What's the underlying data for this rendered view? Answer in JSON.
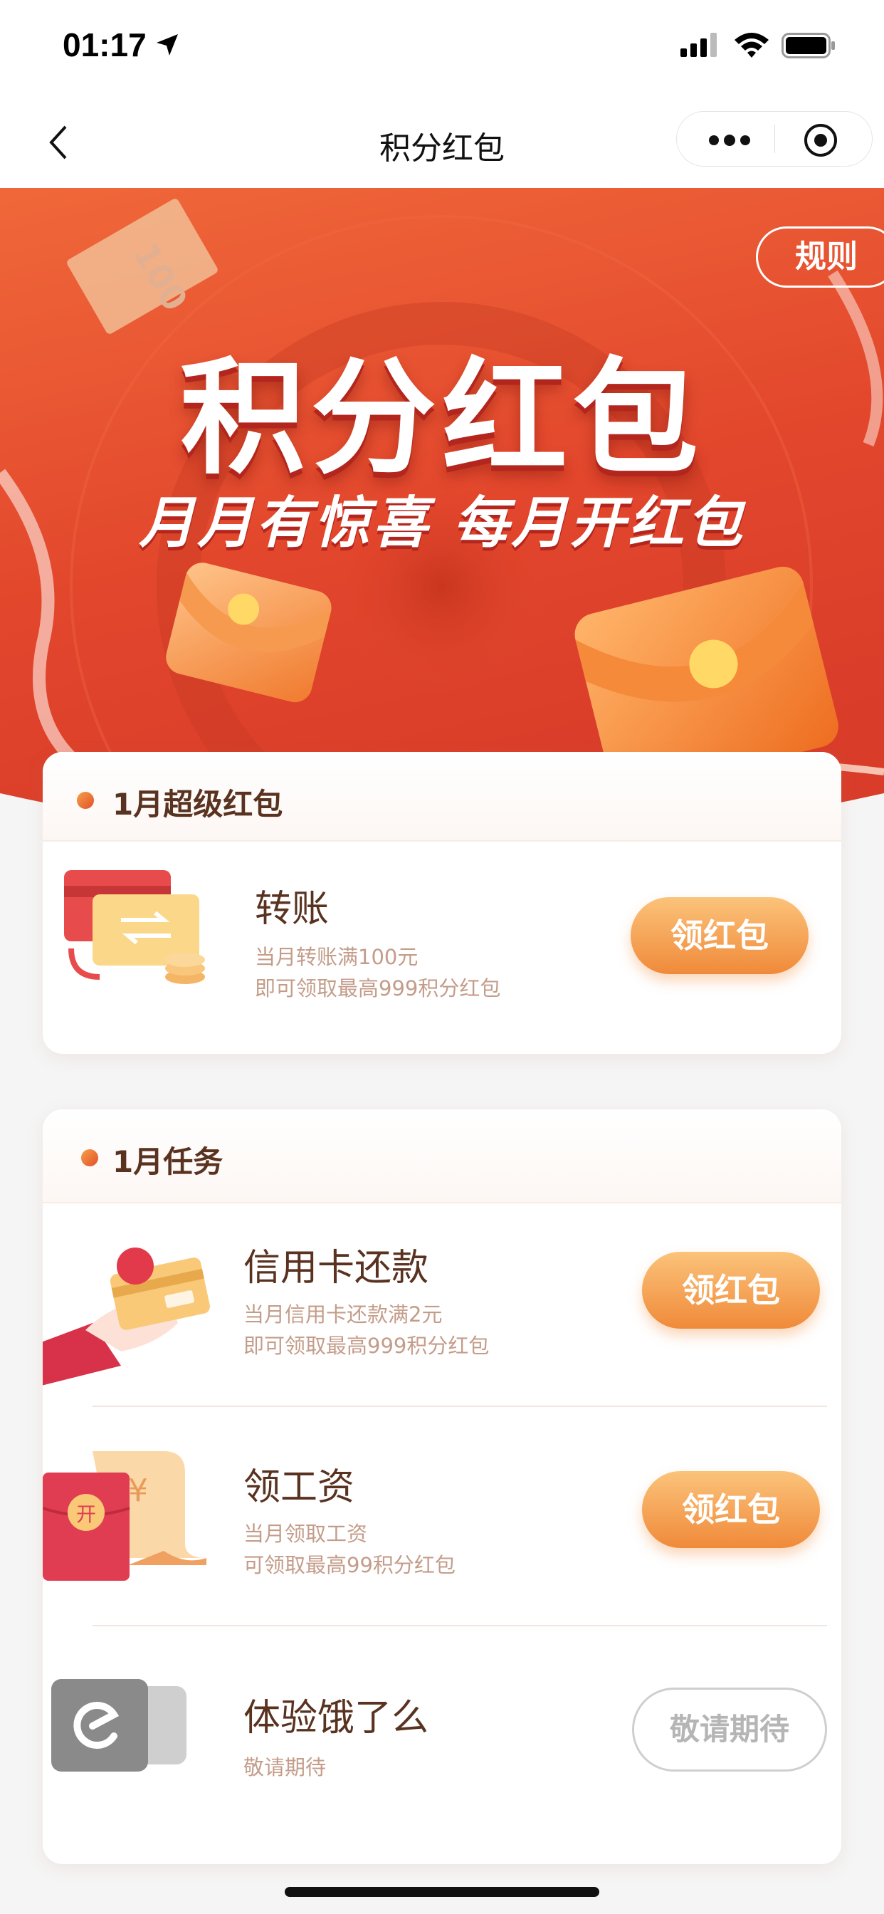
{
  "status_bar": {
    "time": "01:17"
  },
  "nav": {
    "title": "积分红包"
  },
  "hero": {
    "rule_label": "规则",
    "title": "积分红包",
    "subtitle": "月月有惊喜 每月开红包",
    "banknote_text": "100"
  },
  "super_card": {
    "title": "1月超级红包",
    "item": {
      "title": "转账",
      "desc_line1": "当月转账满100元",
      "desc_line2": "即可领取最高999积分红包",
      "button": "领红包"
    }
  },
  "tasks_card": {
    "title": "1月任务",
    "items": [
      {
        "title": "信用卡还款",
        "desc_line1": "当月信用卡还款满2元",
        "desc_line2": "即可领取最高999积分红包",
        "button": "领红包"
      },
      {
        "title": "领工资",
        "desc_line1": "当月领取工资",
        "desc_line2": "可领取最高99积分红包",
        "button": "领红包",
        "envelope_text": "开",
        "yen": "¥"
      },
      {
        "title": "体验饿了么",
        "desc_line1": "敬请期待",
        "button": "敬请期待"
      }
    ]
  },
  "colors": {
    "hero_red": "#e2462c",
    "hero_orange": "#ef6a35",
    "button_top": "#fbc37a",
    "button_bottom": "#f08a3a",
    "text_brown": "#5a3220",
    "desc_tan": "#c49d8a"
  }
}
